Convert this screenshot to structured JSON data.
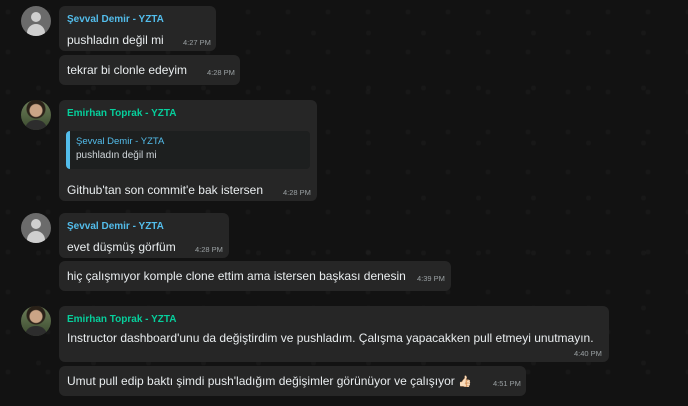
{
  "messages": [
    {
      "sender": "Şevval Demir - YZTA",
      "text": "pushladın değil mi",
      "time": "4:27 PM"
    },
    {
      "text": "tekrar bi clonle edeyim",
      "time": "4:28 PM"
    },
    {
      "sender": "Emirhan Toprak - YZTA",
      "quote": {
        "sender": "Şevval Demir - YZTA",
        "text": "pushladın değil mi"
      },
      "text": "Github'tan son commit'e bak istersen",
      "time": "4:28 PM"
    },
    {
      "sender": "Şevval Demir - YZTA",
      "text": "evet düşmüş görfüm",
      "time": "4:28 PM"
    },
    {
      "text": "hiç çalışmıyor komple clone ettim ama istersen başkası denesin",
      "time": "4:39 PM"
    },
    {
      "sender": "Emirhan Toprak - YZTA",
      "text": "Instructor dashboard'unu da değiştirdim ve pushladım. Çalışma yapacakken pull etmeyi unutmayın.",
      "time": "4:40 PM"
    },
    {
      "text": "Umut pull edip baktı şimdi push'ladığım değişimler görünüyor ve çalışıyor",
      "emoji": "👍🏻",
      "time": "4:51 PM"
    }
  ],
  "colors": {
    "sender_blue": "#53bdeb",
    "sender_green": "#06cf9c",
    "bubble": "#262626",
    "background": "#121212"
  }
}
